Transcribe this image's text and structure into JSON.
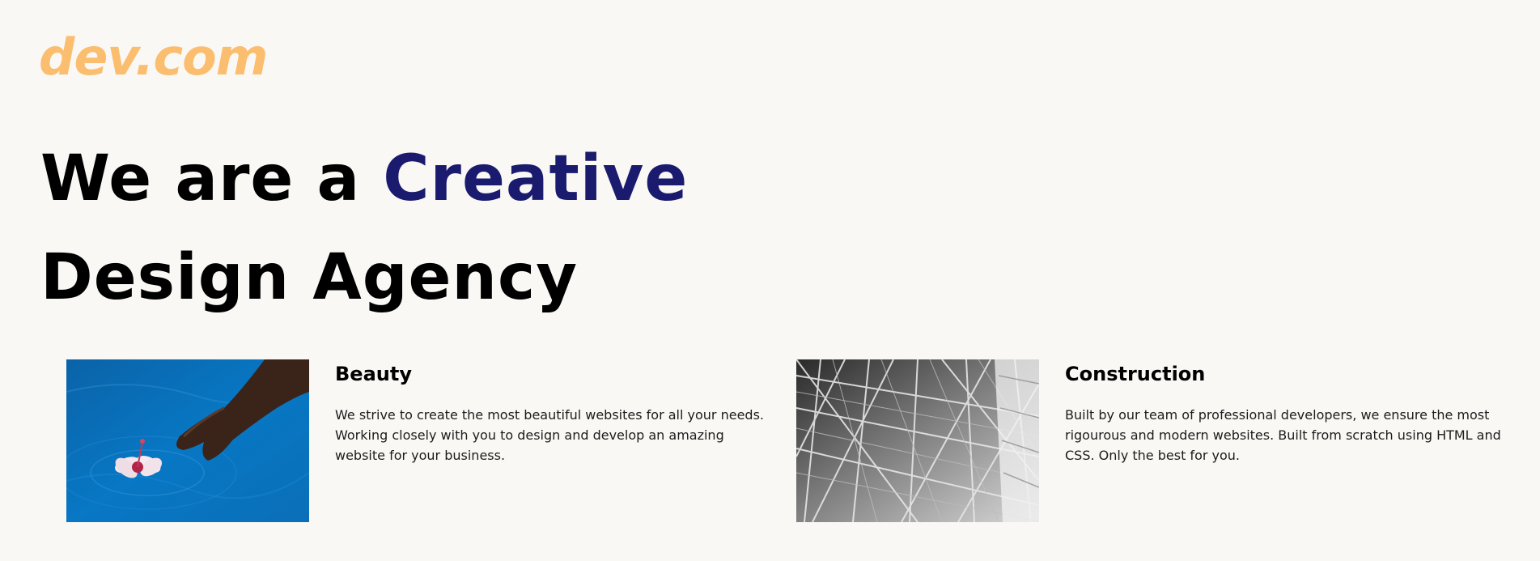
{
  "header": {
    "logo_text": "dev.com"
  },
  "hero": {
    "line1_prefix": "We are a ",
    "line1_accent": "Creative",
    "line2": "Design Agency"
  },
  "colors": {
    "background": "#f9f8f5",
    "logo": "#fbbd6e",
    "accent": "#1a1a6e",
    "text": "#000000"
  },
  "services": [
    {
      "title": "Beauty",
      "description": "We strive to create the most beautiful websites for all your needs. Working closely with you to design and develop an amazing website for your business.",
      "image": "hand-with-hibiscus-flower-in-pool-photo"
    },
    {
      "title": "Construction",
      "description": "Built by our team of professional developers, we ensure the most rigourous and modern websites. Built from scratch using HTML and CSS. Only the best for you.",
      "image": "steel-structure-black-and-white-photo"
    }
  ]
}
